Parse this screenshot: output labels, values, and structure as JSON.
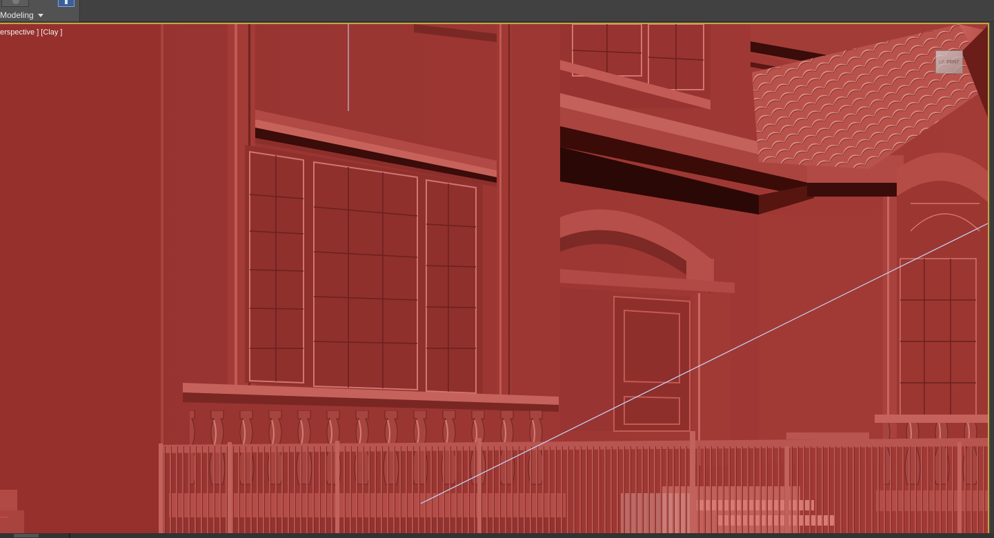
{
  "ribbon": {
    "mode_label": "Modeling",
    "mode_dropdown_icon": "chevron-down-icon",
    "tool_icons": [
      "object-paint-icon",
      "selection-icon"
    ]
  },
  "viewport": {
    "label": "erspective ] [Clay ]",
    "border_color": "#c9a43c",
    "viewcube": {
      "left_face": "LF",
      "front_face": "FRNT"
    }
  },
  "colors": {
    "clay": "#9b3530",
    "clay_shadow": "#2a0806",
    "guide_line": "#c8d8ff",
    "ui_background": "#414141"
  }
}
